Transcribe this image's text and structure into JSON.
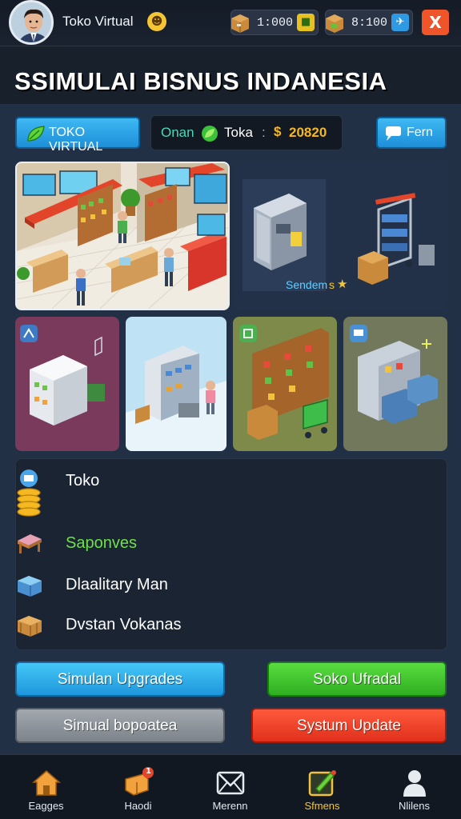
{
  "header": {
    "player_name": "Toko Virtual",
    "emoji": "☻",
    "coins_value": "1:000",
    "gems_value": "8:100",
    "close_symbol": "X"
  },
  "title": "SSIMULAI BISNUS INDANESIA",
  "toolbar": {
    "store_button_label": "TOKO VIRTUAL",
    "status": {
      "left_text": "Onan",
      "mid_text": "Toka",
      "separator": ":",
      "currency_symbol": "$",
      "amount": "20820"
    },
    "fern_button_label": "Fern"
  },
  "scene": {
    "shelf_caption": "Sendem",
    "shelf_caption_suffix": "s"
  },
  "menu": {
    "items": [
      {
        "label": "Toko",
        "color": "#ffffff",
        "icon": "coin-stack-icon"
      },
      {
        "label": "Saponves",
        "color": "#6ee04a",
        "icon": "table-icon"
      },
      {
        "label": "Dlaalitary Man",
        "color": "#ffffff",
        "icon": "storage-box-icon"
      },
      {
        "label": "Dvstan Vokanas",
        "color": "#ffffff",
        "icon": "crate-icon"
      }
    ]
  },
  "actions": {
    "simulan_upgrades": "Simulan Upgrades",
    "soko_ufradal": "Soko Ufradal",
    "simual_bopoatea": "Simual bopoatea",
    "systum_update": "Systum Update"
  },
  "nav": {
    "items": [
      {
        "label": "Eagges",
        "icon": "house-icon"
      },
      {
        "label": "Haodi",
        "icon": "shop-badge-icon",
        "badge": "1"
      },
      {
        "label": "Merenn",
        "icon": "envelope-icon"
      },
      {
        "label": "Sfmens",
        "icon": "edit-icon"
      },
      {
        "label": "Nlilens",
        "icon": "person-icon"
      }
    ]
  },
  "colors": {
    "accent_blue": "#2ea6ea",
    "accent_green": "#3ec42d",
    "accent_red": "#ef3b24",
    "accent_gray": "#8d949c",
    "gold": "#f5b820"
  }
}
